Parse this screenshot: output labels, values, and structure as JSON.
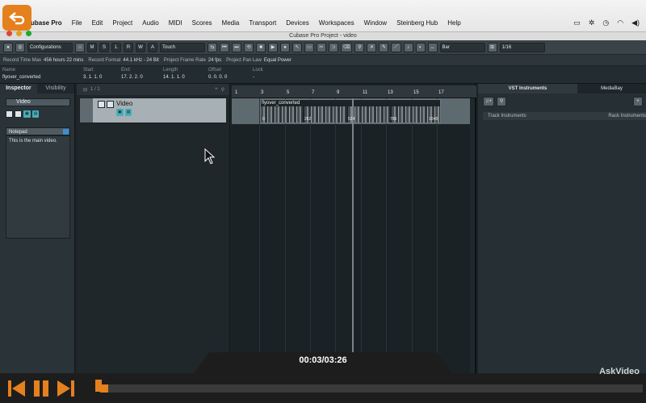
{
  "menubar": {
    "app_partial": "ubase Pro",
    "menus": [
      "File",
      "Edit",
      "Project",
      "Audio",
      "MIDI",
      "Scores",
      "Media",
      "Transport",
      "Devices",
      "Workspaces",
      "Window",
      "Steinberg Hub",
      "Help"
    ]
  },
  "window_title": "Cubase Pro Project - video",
  "toolbar": {
    "configurations": "Configurations",
    "letters": [
      "M",
      "S",
      "L",
      "R",
      "W",
      "A"
    ],
    "automation_mode": "Touch",
    "snap": "Bar",
    "quantize": "1/16"
  },
  "infoline": {
    "items": [
      {
        "label": "Record Time Max",
        "value": "456 hours 22 mins"
      },
      {
        "label": "Record Format",
        "value": "44.1 kHz - 24 Bit"
      },
      {
        "label": "Project Frame Rate",
        "value": "24 fps"
      },
      {
        "label": "Project Pan Law",
        "value": "Equal Power"
      }
    ]
  },
  "event_info": {
    "name": {
      "h": "Name",
      "v": "flyover_converted"
    },
    "start": {
      "h": "Start",
      "v": "3. 1. 1. 0"
    },
    "end": {
      "h": "End",
      "v": "17. 2. 2. 0"
    },
    "length": {
      "h": "Length",
      "v": "14. 1. 1. 0"
    },
    "offset": {
      "h": "Offset",
      "v": "0. 0. 0. 0"
    },
    "lock": {
      "h": "Lock",
      "v": "-"
    }
  },
  "inspector": {
    "tabs": [
      "Inspector",
      "Visibility"
    ],
    "track_name": "Video",
    "notepad_title": "Notepad",
    "notepad_text": "This is the main video."
  },
  "tracklist": {
    "count": "1 / 1",
    "track_name": "Video"
  },
  "project": {
    "ruler_labels": [
      "1",
      "3",
      "5",
      "7",
      "9",
      "11",
      "13",
      "15",
      "17"
    ],
    "clip_name": "flyover_converted",
    "frame_labels": [
      "0",
      "262",
      "524",
      "786",
      "1048"
    ]
  },
  "right_zone": {
    "tab_active": "VST Instruments",
    "tab_inactive": "MediaBay",
    "col_left": "Track Instruments",
    "col_right": "Rack Instruments"
  },
  "player": {
    "timecode": "00:03/03:26",
    "progress": 0.015,
    "watermark": "AskVideo"
  },
  "colors": {
    "accent": "#e4801d",
    "clip_tag": "#49aeb6"
  }
}
